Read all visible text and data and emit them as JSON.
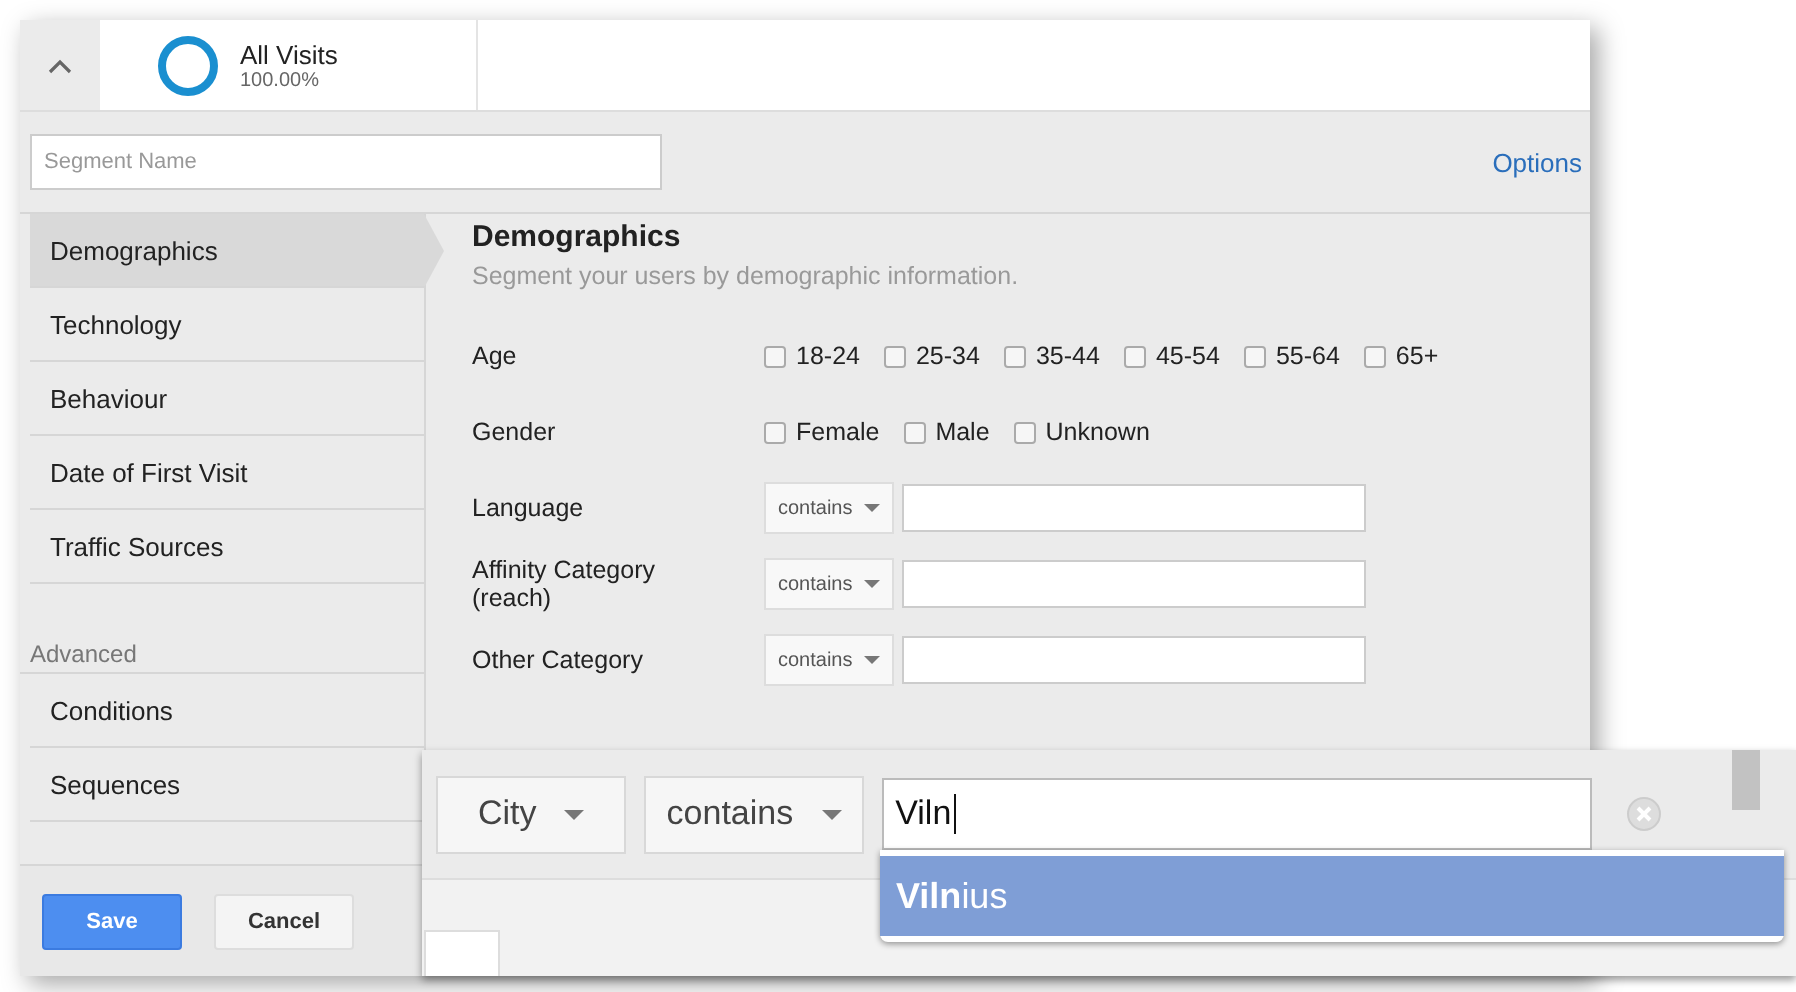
{
  "segment": {
    "title": "All Visits",
    "share": "100.00%"
  },
  "name_field": {
    "placeholder": "Segment Name"
  },
  "options_link": "Options",
  "sidebar": {
    "items": [
      {
        "label": "Demographics",
        "selected": true
      },
      {
        "label": "Technology",
        "selected": false
      },
      {
        "label": "Behaviour",
        "selected": false
      },
      {
        "label": "Date of First Visit",
        "selected": false
      },
      {
        "label": "Traffic Sources",
        "selected": false
      }
    ],
    "advanced_heading": "Advanced",
    "advanced_items": [
      {
        "label": "Conditions",
        "selected": false
      },
      {
        "label": "Sequences",
        "selected": false
      }
    ]
  },
  "content": {
    "title": "Demographics",
    "subtitle": "Segment your users by demographic information.",
    "rows": [
      {
        "kind": "checks",
        "label": "Age",
        "options": [
          {
            "label": "18-24",
            "checked": false
          },
          {
            "label": "25-34",
            "checked": false
          },
          {
            "label": "35-44",
            "checked": false
          },
          {
            "label": "45-54",
            "checked": false
          },
          {
            "label": "55-64",
            "checked": false
          },
          {
            "label": "65+",
            "checked": false
          }
        ]
      },
      {
        "kind": "checks",
        "label": "Gender",
        "options": [
          {
            "label": "Female",
            "checked": false
          },
          {
            "label": "Male",
            "checked": false
          },
          {
            "label": "Unknown",
            "checked": false
          }
        ]
      },
      {
        "kind": "match",
        "label": "Language",
        "operator": "contains"
      },
      {
        "kind": "match",
        "label": "Affinity Category (reach)",
        "operator": "contains"
      },
      {
        "kind": "match",
        "label": "Other Category",
        "operator": "contains"
      }
    ]
  },
  "buttons": {
    "save": "Save",
    "cancel": "Cancel"
  },
  "zoom": {
    "dimension": "City",
    "operator": "contains",
    "value": "Viln",
    "suggestions": [
      {
        "label": "**Viln**ius",
        "selected": true
      }
    ]
  }
}
